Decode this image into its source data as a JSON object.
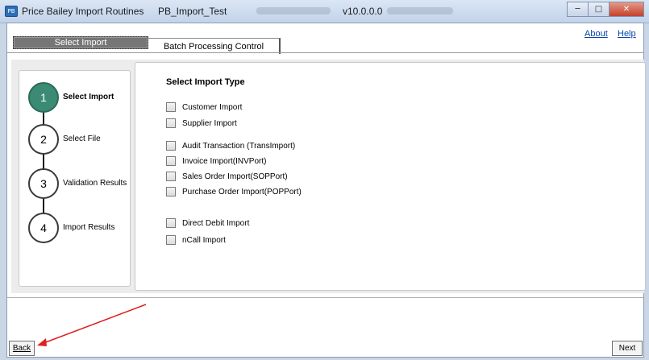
{
  "titlebar": {
    "app_title": "Price Bailey Import Routines",
    "database": "PB_Import_Test",
    "version": "v10.0.0.0",
    "icon": "app-icon",
    "minimize": "─",
    "maximize": "□",
    "close": "✕"
  },
  "links": {
    "about": "About",
    "help": "Help"
  },
  "tabs": [
    {
      "label": "Select Import"
    },
    {
      "label": "Batch Processing Control"
    }
  ],
  "steps": [
    {
      "number": "1",
      "label": "Select Import"
    },
    {
      "number": "2",
      "label": "Select File"
    },
    {
      "number": "3",
      "label": "Validation Results"
    },
    {
      "number": "4",
      "label": "Import Results"
    }
  ],
  "import_type": {
    "heading": "Select Import Type",
    "options": [
      "Customer Import",
      "Supplier Import",
      "Audit Transaction (TransImport)",
      "Invoice Import(INVPort)",
      "Sales Order Import(SOPPort)",
      "Purchase Order Import(POPPort)",
      "Direct Debit Import",
      "nCall Import"
    ]
  },
  "buttons": {
    "back": "Back",
    "next": "Next"
  },
  "colors": {
    "active_step": "#3b8a74",
    "annotation_arrow": "#e02020"
  }
}
